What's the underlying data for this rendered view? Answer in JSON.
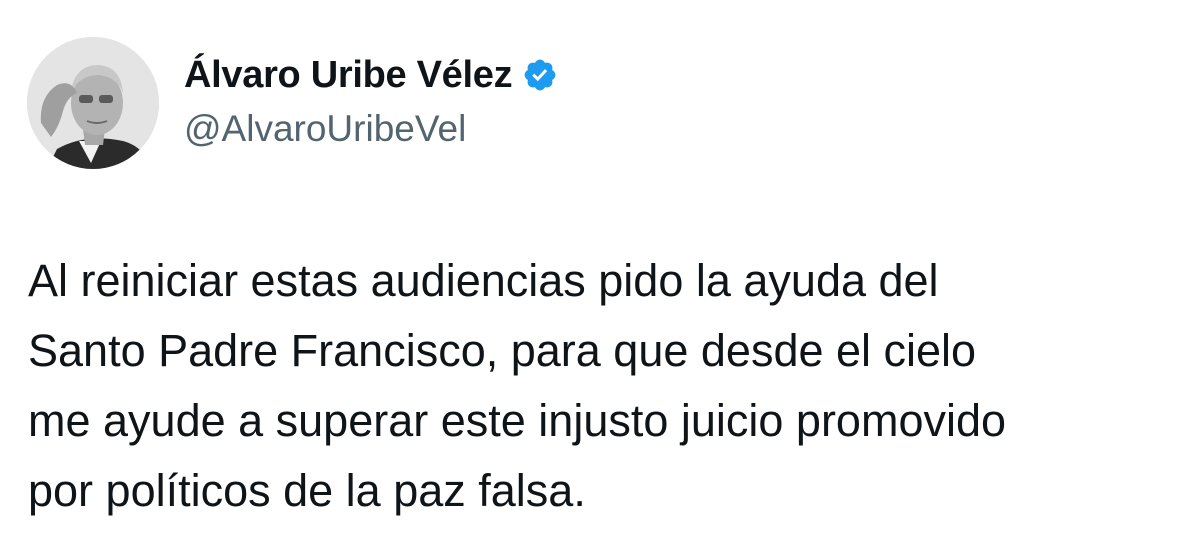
{
  "author": {
    "display_name": "Álvaro Uribe Vélez",
    "handle": "@AlvaroUribeVel",
    "verified": true,
    "verified_icon": "verified-badge-icon",
    "verified_color": "#1d9bf0",
    "avatar": "profile-photo"
  },
  "tweet": {
    "text_lines": [
      "Al reiniciar estas audiencias pido la ayuda del",
      "Santo Padre Francisco, para que desde el cielo",
      "me ayude a superar este injusto juicio promovido",
      "por políticos de la paz falsa."
    ]
  },
  "colors": {
    "text": "#0f1419",
    "secondary_text": "#536471",
    "background": "#ffffff"
  }
}
